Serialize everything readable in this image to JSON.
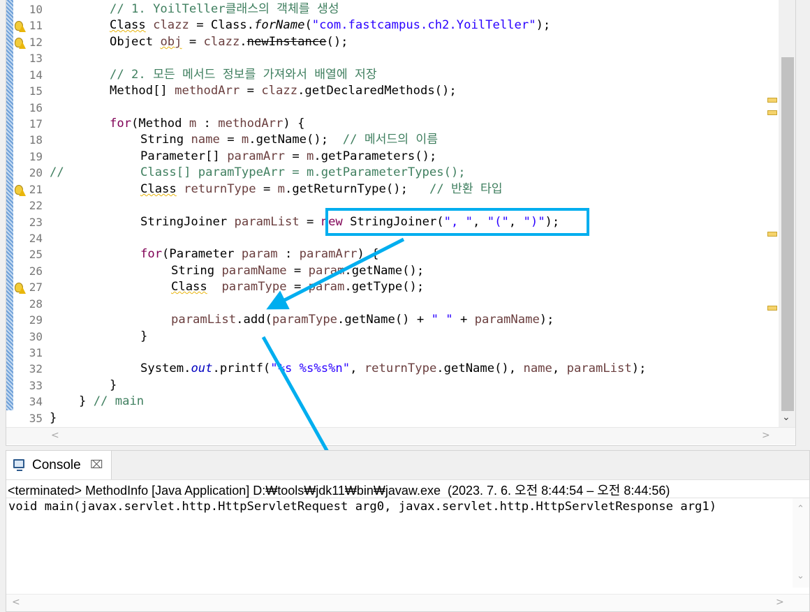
{
  "editor": {
    "line_numbers": [
      "10",
      "11",
      "12",
      "13",
      "14",
      "15",
      "16",
      "17",
      "18",
      "19",
      "20",
      "21",
      "22",
      "23",
      "24",
      "25",
      "26",
      "27",
      "28",
      "29",
      "30",
      "31",
      "32",
      "33",
      "34",
      "35"
    ],
    "code": {
      "l10": "// 1. YoilTeller클래스의 객체를 생성",
      "l11": {
        "cls": "Class",
        "var": "clazz",
        "eq": " = Class.",
        "method": "forName",
        "arg": "\"com.fastcampus.ch2.YoilTeller\"",
        "end": ");"
      },
      "l12": {
        "type": "Object",
        "var": "obj",
        "eq": " = ",
        "ref": "clazz",
        "method": "newInstance",
        "end": "();"
      },
      "l14": "// 2. 모든 메서드 정보를 가져와서 배열에 저장",
      "l15": {
        "type": "Method[] ",
        "var": "methodArr",
        "eq": " = ",
        "ref": "clazz",
        "rest": ".getDeclaredMethods();"
      },
      "l17": {
        "kw": "for",
        "open": "(Method ",
        "var": "m",
        "colon": " : ",
        "ref": "methodArr",
        "end": ") {"
      },
      "l18": {
        "type": "String ",
        "var": "name",
        "eq": " = ",
        "ref": "m",
        "rest": ".getName();  ",
        "comment": "// 메서드의 이름"
      },
      "l19": {
        "type": "Parameter[] ",
        "var": "paramArr",
        "eq": " = ",
        "ref": "m",
        "rest": ".getParameters();"
      },
      "l20": {
        "prefix": "//",
        "text": "Class[] paramTypeArr = m.getParameterTypes();"
      },
      "l21": {
        "type": "Class",
        "var": "returnType",
        "eq": " = ",
        "ref": "m",
        "rest": ".getReturnType();   ",
        "comment": "// 반환 타입"
      },
      "l23": {
        "type": "StringJoiner ",
        "var": "paramList",
        "eq": " = ",
        "kw": "new",
        "mid": " StringJoiner(",
        "s1": "\", \"",
        "c1": ", ",
        "s2": "\"(\"",
        "c2": ", ",
        "s3": "\")\"",
        "end": ");"
      },
      "l25": {
        "kw": "for",
        "open": "(Parameter ",
        "var": "param",
        "colon": " : ",
        "ref": "paramArr",
        "end": ") {"
      },
      "l26": {
        "type": "String ",
        "var": "paramName",
        "eq": " = ",
        "ref": "param",
        "rest": ".getName();"
      },
      "l27": {
        "type": "Class",
        "gap": "  ",
        "var": "paramType",
        "eq": " = ",
        "ref": "param",
        "rest": ".getType();"
      },
      "l29": {
        "ref": "paramList",
        "mid": ".add(",
        "ref2": "paramType",
        "mid2": ".getName() + ",
        "str": "\" \"",
        "plus": " + ",
        "ref3": "paramName",
        "end": ");"
      },
      "l30": "}",
      "l32": {
        "start": "System.",
        "field": "out",
        "mid": ".printf(",
        "str": "\"%s %s%s%n\"",
        "c1": ", ",
        "ref1": "returnType",
        "mid2": ".getName(), ",
        "ref2": "name",
        "c2": ", ",
        "ref3": "paramList",
        "end": ");"
      },
      "l33": "}",
      "l34": {
        "brace": "} ",
        "comment": "// main"
      },
      "l35": "}"
    },
    "highlight_color": "#00aeef"
  },
  "console": {
    "title": "Console",
    "close_icon": "close-icon",
    "status": "<terminated> MethodInfo [Java Application] D:₩tools₩jdk11₩bin₩javaw.exe  (2023. 7. 6. 오전 8:44:54 – 오전 8:44:56)",
    "output": "void main(javax.servlet.http.HttpServletRequest arg0, javax.servlet.http.HttpServletResponse arg1)"
  },
  "colors": {
    "comment": "#3f7f5f",
    "keyword": "#7f0055",
    "string": "#2a00ff",
    "field": "#0000c0",
    "local_var": "#6a3e3e",
    "annotation_arrow": "#00aeef"
  }
}
